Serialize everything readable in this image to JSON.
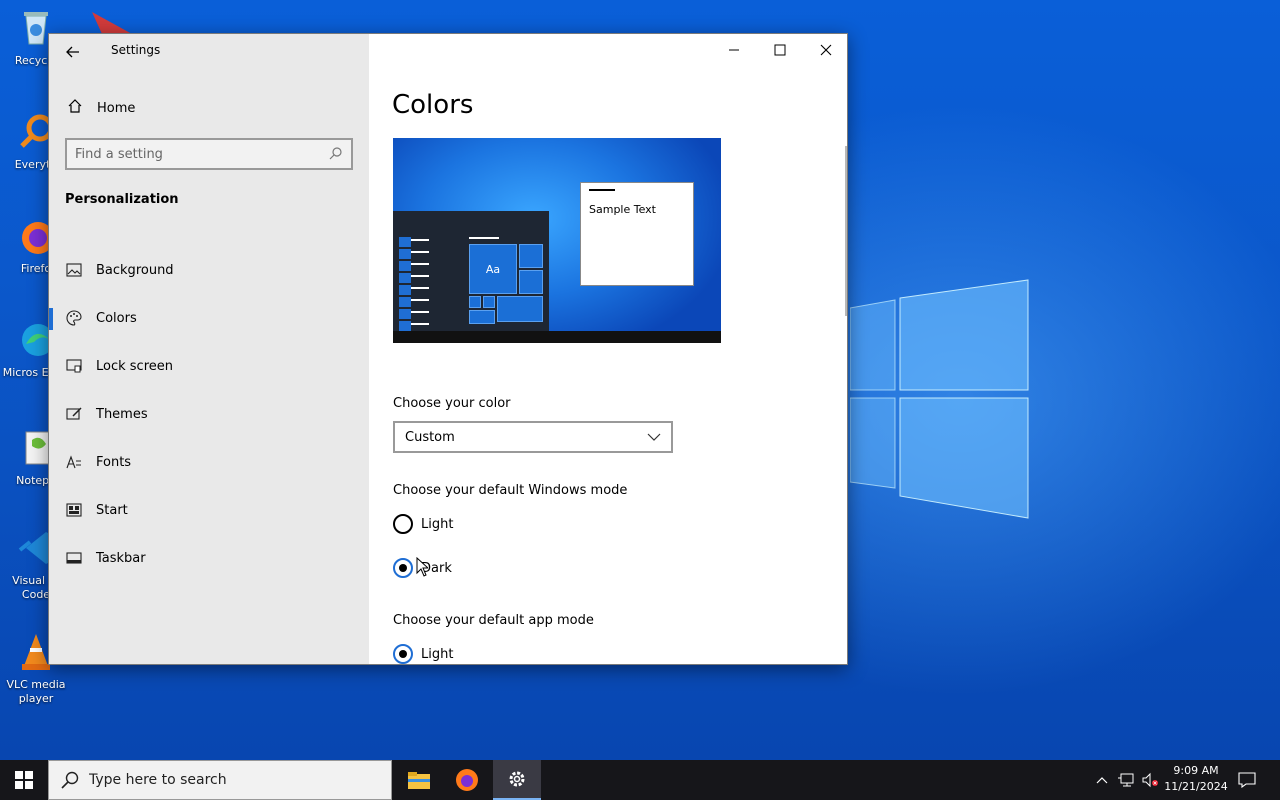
{
  "desktop": {
    "icons": [
      {
        "label": "Recycle",
        "icon": "recycle-bin-icon"
      },
      {
        "label": "Everyth",
        "icon": "everything-search-icon"
      },
      {
        "label": "Firefo",
        "icon": "firefox-icon"
      },
      {
        "label": "Micros Edge",
        "icon": "edge-icon"
      },
      {
        "label": "Notepa",
        "icon": "notepad-icon"
      },
      {
        "label": "Visual St Code",
        "icon": "vscode-icon"
      },
      {
        "label": "VLC media player",
        "icon": "vlc-icon"
      }
    ]
  },
  "window": {
    "title": "Settings",
    "controls": {
      "minimize": "—",
      "maximize": "☐",
      "close": "✕"
    }
  },
  "nav": {
    "home": "Home",
    "search_placeholder": "Find a setting",
    "section": "Personalization",
    "items": [
      {
        "label": "Background",
        "icon": "image-icon"
      },
      {
        "label": "Colors",
        "icon": "palette-icon",
        "active": true
      },
      {
        "label": "Lock screen",
        "icon": "lock-screen-icon"
      },
      {
        "label": "Themes",
        "icon": "brush-icon"
      },
      {
        "label": "Fonts",
        "icon": "font-icon"
      },
      {
        "label": "Start",
        "icon": "start-icon"
      },
      {
        "label": "Taskbar",
        "icon": "taskbar-icon"
      }
    ]
  },
  "content": {
    "title": "Colors",
    "preview": {
      "sample_text": "Sample Text",
      "tile_label": "Aa"
    },
    "choose_color_label": "Choose your color",
    "choose_color_value": "Custom",
    "windows_mode_label": "Choose your default Windows mode",
    "windows_mode_options": [
      {
        "label": "Light",
        "checked": false
      },
      {
        "label": "Dark",
        "checked": true
      }
    ],
    "app_mode_label": "Choose your default app mode",
    "app_mode_options": [
      {
        "label": "Light",
        "checked": true
      }
    ]
  },
  "taskbar": {
    "search_placeholder": "Type here to search",
    "apps": [
      "file-explorer-icon",
      "firefox-icon",
      "settings-gear-icon"
    ],
    "clock_time": "9:09 AM",
    "clock_date": "11/21/2024"
  },
  "colors": {
    "accent": "#1f6ed4",
    "nav_bg": "#e9e9e9",
    "taskbar_bg": "#16161a"
  }
}
